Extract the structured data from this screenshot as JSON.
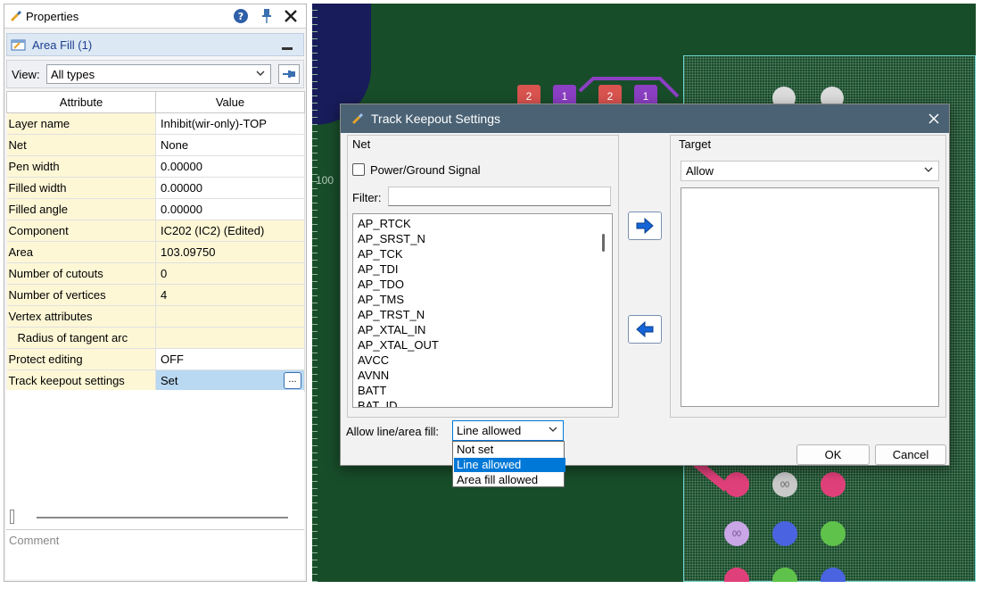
{
  "properties": {
    "title": "Properties",
    "subtitle": "Area Fill (1)",
    "view_label": "View:",
    "view_value": "All types",
    "col_attribute": "Attribute",
    "col_value": "Value",
    "rows": [
      {
        "attr": "Layer name",
        "value": "Inhibit(wir-only)-TOP"
      },
      {
        "attr": "Net",
        "value": "None"
      },
      {
        "attr": "Pen width",
        "value": "0.00000"
      },
      {
        "attr": "Filled width",
        "value": "0.00000"
      },
      {
        "attr": "Filled angle",
        "value": "0.00000"
      },
      {
        "attr": "Component",
        "value": "IC202 (IC2) (Edited)"
      },
      {
        "attr": "Area",
        "value": "103.09750"
      },
      {
        "attr": "Number of cutouts",
        "value": "0"
      },
      {
        "attr": "Number of vertices",
        "value": "4"
      },
      {
        "attr": "Vertex attributes",
        "value": ""
      },
      {
        "attr": "Radius of tangent arc",
        "value": ""
      },
      {
        "attr": "Protect editing",
        "value": "OFF"
      },
      {
        "attr": "Track keepout settings",
        "value": "Set"
      }
    ],
    "ellipsis": "...",
    "comment_label": "Comment"
  },
  "pcb": {
    "ruler_label": "100",
    "pads": [
      "2",
      "1",
      "2",
      "1"
    ],
    "pad_labels": [
      "00",
      "00",
      "00"
    ]
  },
  "dialog": {
    "title": "Track Keepout Settings",
    "net_group": "Net",
    "power_ground": "Power/Ground Signal",
    "filter_label": "Filter:",
    "filter_value": "",
    "net_items": [
      "AP_RTCK",
      "AP_SRST_N",
      "AP_TCK",
      "AP_TDI",
      "AP_TDO",
      "AP_TMS",
      "AP_TRST_N",
      "AP_XTAL_IN",
      "AP_XTAL_OUT",
      "AVCC",
      "AVNN",
      "BATT",
      "BAT_ID"
    ],
    "target_group": "Target",
    "target_value": "Allow",
    "allow_label": "Allow line/area fill:",
    "allow_value": "Line allowed",
    "allow_options": [
      "Not set",
      "Line allowed",
      "Area fill allowed"
    ],
    "ok": "OK",
    "cancel": "Cancel"
  },
  "colors": {
    "accent": "#0078d7",
    "dialog_title": "#4a6274",
    "pcb_bg": "#184d2a"
  }
}
